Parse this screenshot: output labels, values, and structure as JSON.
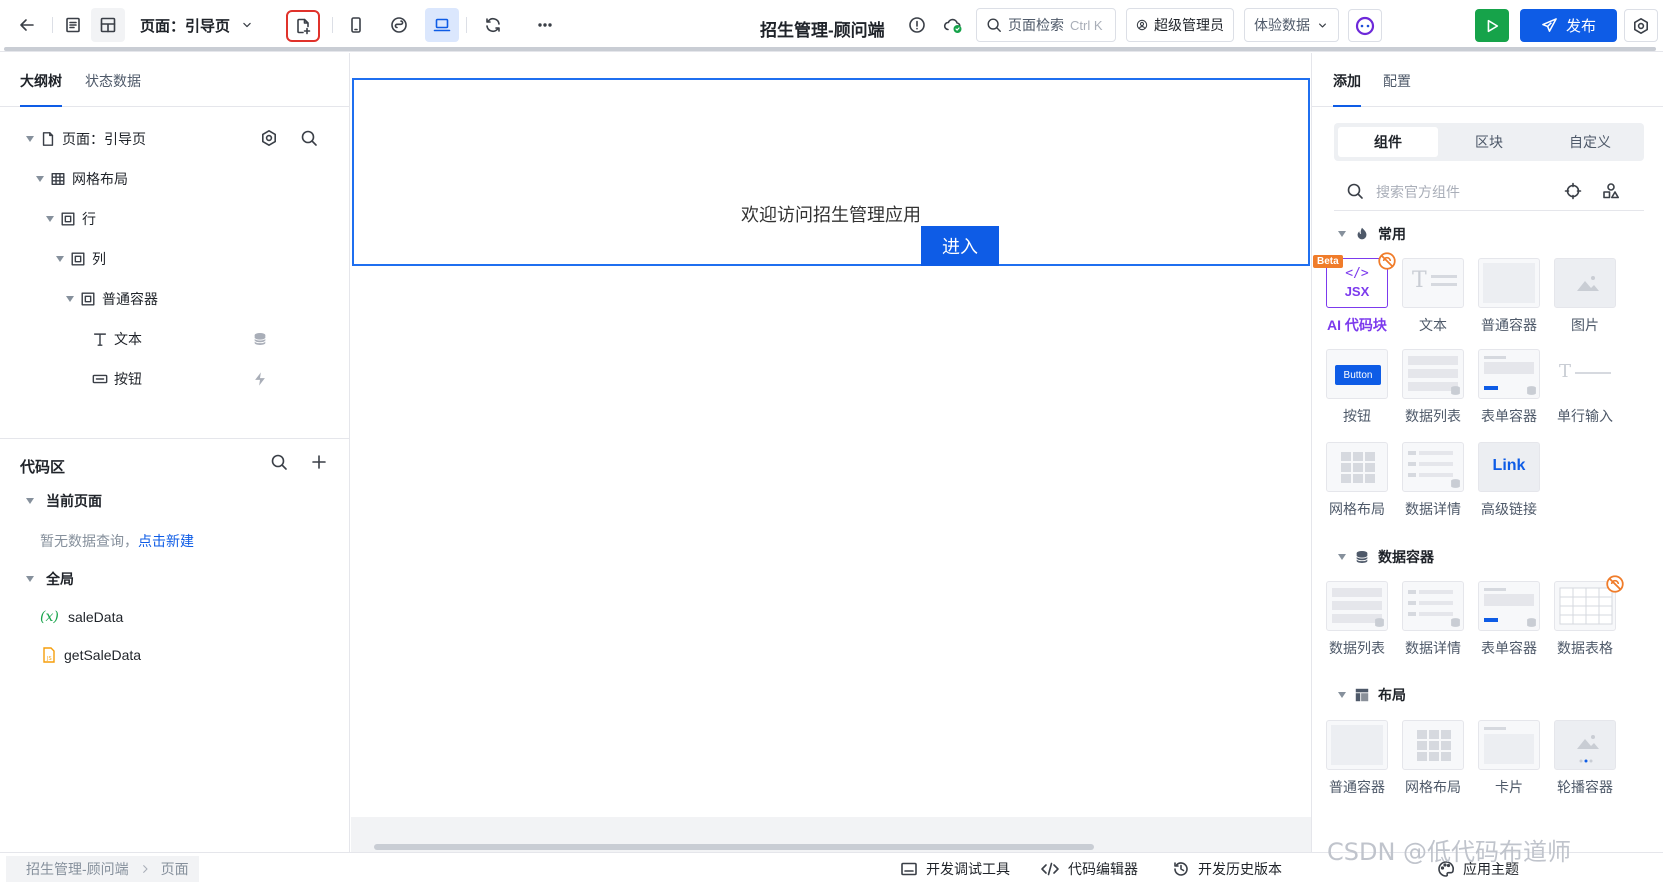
{
  "topbar": {
    "page_selector": "页面：引导页",
    "app_title": "招生管理-顾问端",
    "search_placeholder": "页面检索",
    "search_shortcut": "Ctrl K",
    "user_button": "超级管理员",
    "data_select": "体验数据",
    "publish_label": "发布"
  },
  "left": {
    "tabs": [
      "大纲树",
      "状态数据"
    ],
    "tree": [
      "页面：引导页",
      "网格布局",
      "行",
      "列",
      "普通容器",
      "文本",
      "按钮"
    ],
    "code_area": {
      "title": "代码区",
      "current_page": "当前页面",
      "empty_text": "暂无数据查询，",
      "create_link": "点击新建",
      "global": "全局",
      "items": [
        "saleData",
        "getSaleData"
      ]
    }
  },
  "canvas": {
    "welcome_text": "欢迎访问招生管理应用",
    "enter_button": "进入"
  },
  "right": {
    "tabs": [
      "添加",
      "配置"
    ],
    "segments": [
      "组件",
      "区块",
      "自定义"
    ],
    "search_placeholder": "搜索官方组件",
    "sections": {
      "common": {
        "title": "常用",
        "items": [
          "AI 代码块",
          "文本",
          "普通容器",
          "图片",
          "按钮",
          "数据列表",
          "表单容器",
          "单行输入",
          "网格布局",
          "数据详情",
          "高级链接"
        ]
      },
      "data": {
        "title": "数据容器",
        "items": [
          "数据列表",
          "数据详情",
          "表单容器",
          "数据表格"
        ]
      },
      "layout": {
        "title": "布局",
        "items": [
          "普通容器",
          "网格布局",
          "卡片",
          "轮播容器"
        ]
      }
    },
    "thumb_text": {
      "beta": "Beta",
      "jsx": "JSX",
      "button": "Button",
      "link": "Link"
    }
  },
  "status": {
    "breadcrumb": [
      "招生管理-顾问端",
      "页面"
    ],
    "dev_tools": "开发调试工具",
    "code_editor": "代码编辑器",
    "history": "开发历史版本",
    "theme": "应用主题"
  },
  "watermark": "CSDN @低代码布道师",
  "colors": {
    "primary": "#0e5ce6",
    "run": "#16a34a",
    "ai_purple": "#7c3aed",
    "beta_orange": "#f07c2a",
    "highlight_red": "#e0322b"
  }
}
